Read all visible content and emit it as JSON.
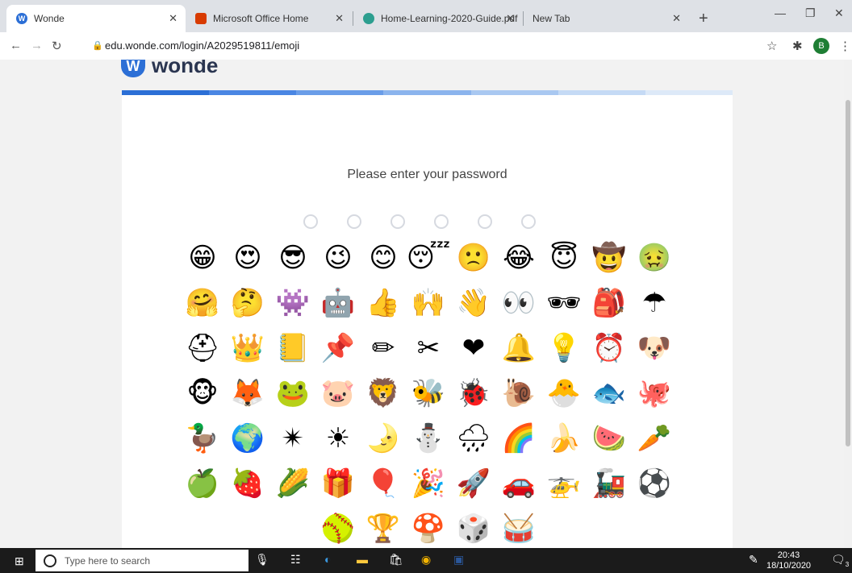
{
  "browser": {
    "tabs": [
      {
        "label": "Wonde",
        "active": true
      },
      {
        "label": "Microsoft Office Home",
        "active": false
      },
      {
        "label": "Home-Learning-2020-Guide.pdf",
        "active": false
      },
      {
        "label": "New Tab",
        "active": false
      }
    ],
    "url": "edu.wonde.com/login/A2029519811/emoji",
    "profile_initial": "B"
  },
  "page": {
    "logo_text": "wonde",
    "prompt": "Please enter your password",
    "password_length": 6,
    "progress_colors": [
      "#2c6fd6",
      "#4a86e3",
      "#6a9de8",
      "#8bb4ed",
      "#a9c8f1",
      "#c5daf5",
      "#dde9f8"
    ],
    "emoji_rows": [
      [
        "😁",
        "😍",
        "😎",
        "😉",
        "😊",
        "😴",
        "🙁",
        "😂",
        "😇",
        "🤠",
        "🤢"
      ],
      [
        "🤗",
        "🤔",
        "👾",
        "🤖",
        "👍",
        "🙌",
        "👋",
        "👀",
        "🕶",
        "🎒",
        "☂"
      ],
      [
        "⛑",
        "👑",
        "📒",
        "📌",
        "✏",
        "✂",
        "❤",
        "🔔",
        "💡",
        "⏰",
        "🐶"
      ],
      [
        "🐵",
        "🦊",
        "🐸",
        "🐷",
        "🦁",
        "🐝",
        "🐞",
        "🐌",
        "🐣",
        "🐟",
        "🐙"
      ],
      [
        "🦆",
        "🌍",
        "✴",
        "☀",
        "🌛",
        "⛄",
        "🌧",
        "🌈",
        "🍌",
        "🍉",
        "🥕"
      ],
      [
        "🍏",
        "🍓",
        "🌽",
        "🎁",
        "🎈",
        "🎉",
        "🚀",
        "🚗",
        "🚁",
        "🚂",
        "⚽"
      ],
      [
        "🥎",
        "🏆",
        "🍄",
        "🎲",
        "🥁"
      ]
    ]
  },
  "taskbar": {
    "search_placeholder": "Type here to search",
    "time": "20:43",
    "date": "18/10/2020",
    "notification_count": "3"
  }
}
